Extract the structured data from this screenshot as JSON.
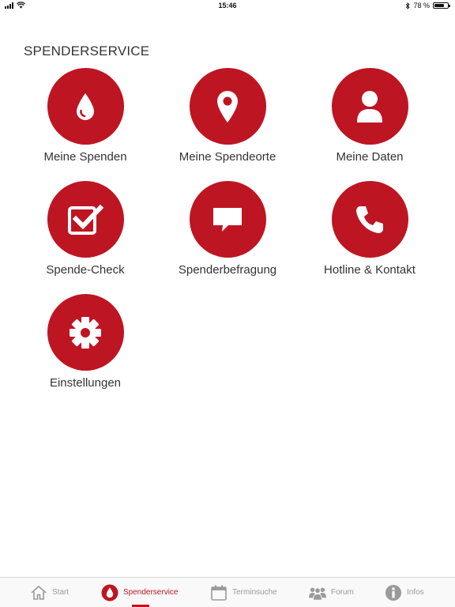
{
  "status_bar": {
    "time": "15:46",
    "battery": "78 %",
    "battery_level": 0.78
  },
  "section": {
    "title": "SPENDERSERVICE"
  },
  "tiles": [
    {
      "label": "Meine Spenden",
      "icon": "drop-icon"
    },
    {
      "label": "Meine Spendeorte",
      "icon": "map-pin-icon"
    },
    {
      "label": "Meine Daten",
      "icon": "person-icon"
    },
    {
      "label": "Spende-Check",
      "icon": "checkbox-icon"
    },
    {
      "label": "Spenderbefragung",
      "icon": "speech-bubble-icon"
    },
    {
      "label": "Hotline & Kontakt",
      "icon": "phone-icon"
    },
    {
      "label": "Einstellungen",
      "icon": "gear-icon"
    }
  ],
  "tabbar": {
    "active": "Spenderservice",
    "tabs": [
      {
        "label": "Start",
        "icon": "home-icon"
      },
      {
        "label": "Spenderservice",
        "icon": "drop-icon"
      },
      {
        "label": "Terminsuche",
        "icon": "calendar-icon"
      },
      {
        "label": "Forum",
        "icon": "people-icon"
      },
      {
        "label": "Infos",
        "icon": "info-icon"
      }
    ]
  },
  "colors": {
    "accent": "#be1522",
    "text": "#333333",
    "tab_inactive": "#9a9a9a"
  }
}
